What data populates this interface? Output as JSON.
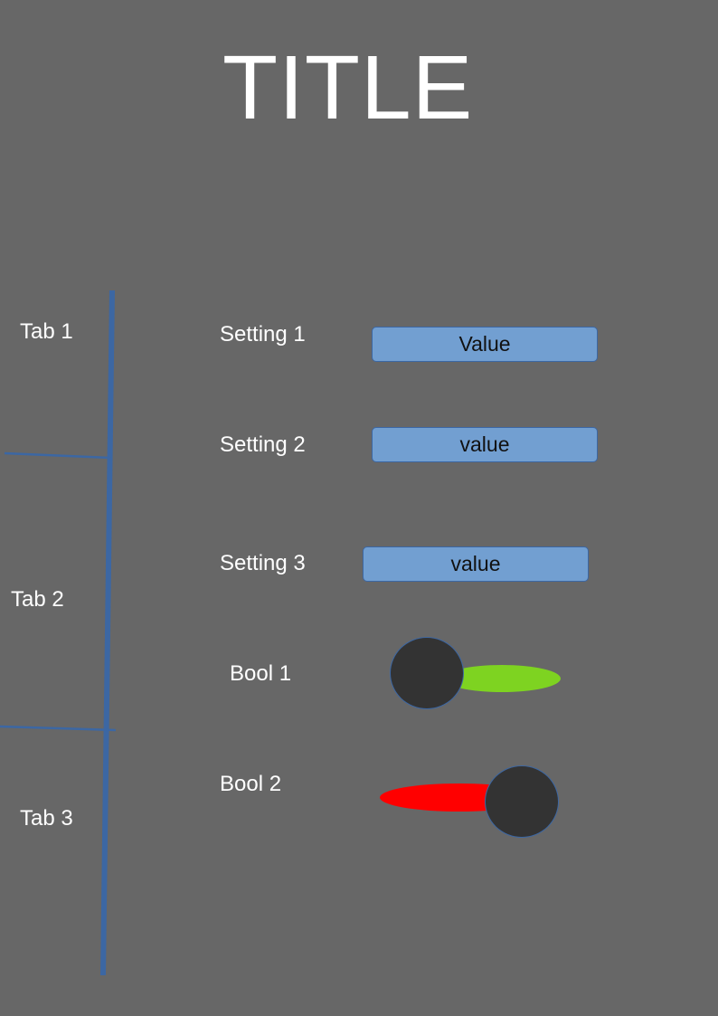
{
  "page": {
    "title": "TITLE",
    "background_color": "#676767"
  },
  "tabs": [
    {
      "label": "Tab 1"
    },
    {
      "label": "Tab 2"
    },
    {
      "label": "Tab 3"
    }
  ],
  "settings": [
    {
      "label": "Setting 1",
      "value": "Value"
    },
    {
      "label": "Setting 2",
      "value": "value"
    },
    {
      "label": "Setting 3",
      "value": "value"
    }
  ],
  "booleans": [
    {
      "label": "Bool 1",
      "state": true,
      "track_color": "#7ed321"
    },
    {
      "label": "Bool 2",
      "state": false,
      "track_color": "#ff0000"
    }
  ],
  "colors": {
    "accent": "#3c67a3",
    "value_box": "#729fd1",
    "knob": "#333333",
    "text": "#ffffff"
  }
}
